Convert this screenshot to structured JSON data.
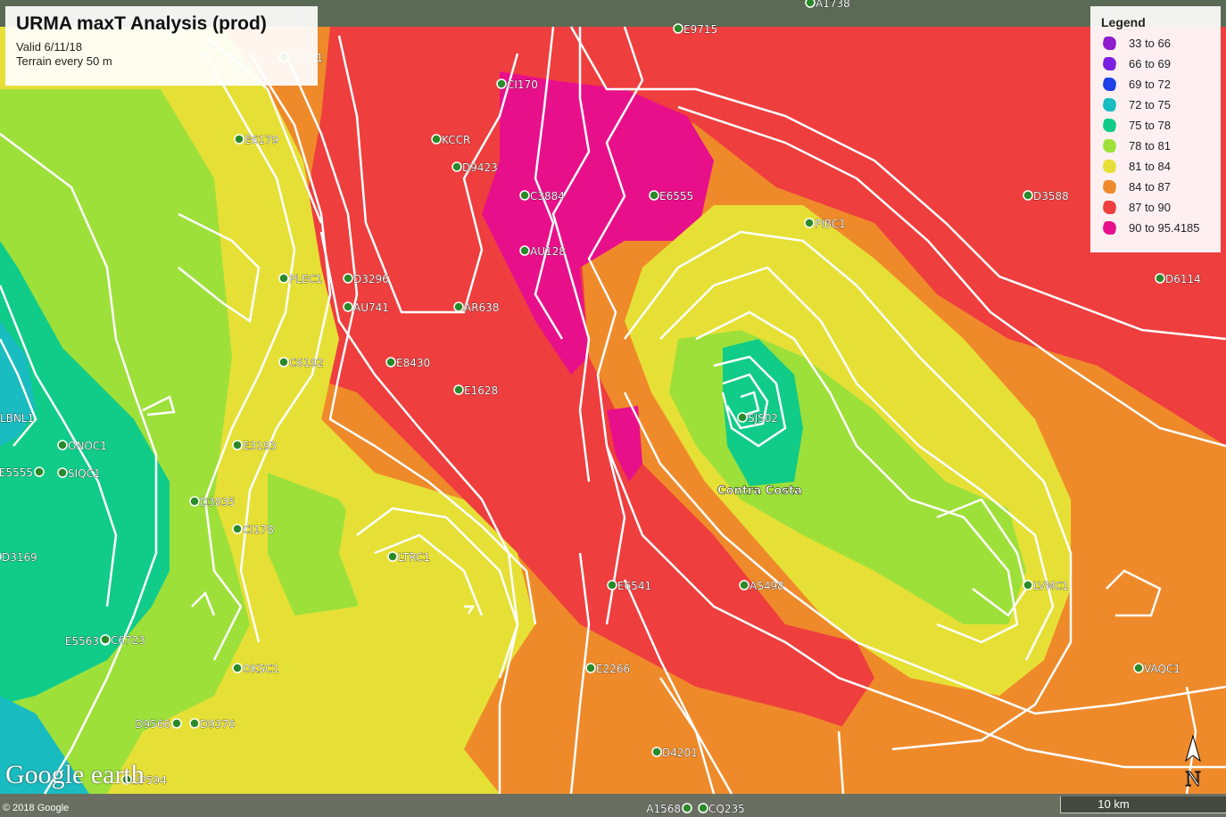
{
  "title": "URMA maxT Analysis (prod)",
  "subtitle_lines": [
    "Valid 6/11/18",
    "Terrain every 50 m"
  ],
  "legend": {
    "heading": "Legend",
    "items": [
      {
        "label": "33 to 66",
        "color": "#8e1ccc"
      },
      {
        "label": "66 to 69",
        "color": "#7b1fe0"
      },
      {
        "label": "69 to 72",
        "color": "#2040e8"
      },
      {
        "label": "72 to 75",
        "color": "#19bcc0"
      },
      {
        "label": "75 to 78",
        "color": "#10cc88"
      },
      {
        "label": "78 to 81",
        "color": "#9ee03a"
      },
      {
        "label": "81 to 84",
        "color": "#e6e036"
      },
      {
        "label": "84 to 87",
        "color": "#ef8a2a"
      },
      {
        "label": "87 to 90",
        "color": "#ef3e3e"
      },
      {
        "label": "90 to 95.4185",
        "color": "#e8108a"
      }
    ]
  },
  "place_label": "Contra Costa",
  "stations": [
    "E9715",
    "A1738",
    "E7741",
    "CI170",
    "E6179",
    "KCCR",
    "D9423",
    "C3884",
    "E6555",
    "D3588",
    "PIBC1",
    "AU128",
    "D6114",
    "PLEC1",
    "D3296",
    "AU741",
    "AR638",
    "C6192",
    "E8430",
    "E1628",
    "LBNL1",
    "SJS02",
    "ONOC1",
    "E5555",
    "SIQC1",
    "E3193",
    "D3835",
    "CI178",
    "D3169",
    "LTRC1",
    "E6541",
    "AS498",
    "LVMC1",
    "E5563",
    "C6723",
    "OKSC1",
    "E2266",
    "VAQC1",
    "D9566",
    "D9376",
    "D4201",
    "UP594",
    "A1568",
    "CQ235"
  ],
  "scale_label": "10 km",
  "compass_label": "N",
  "logo_text": "Google earth",
  "copyright": "© 2018 Google"
}
